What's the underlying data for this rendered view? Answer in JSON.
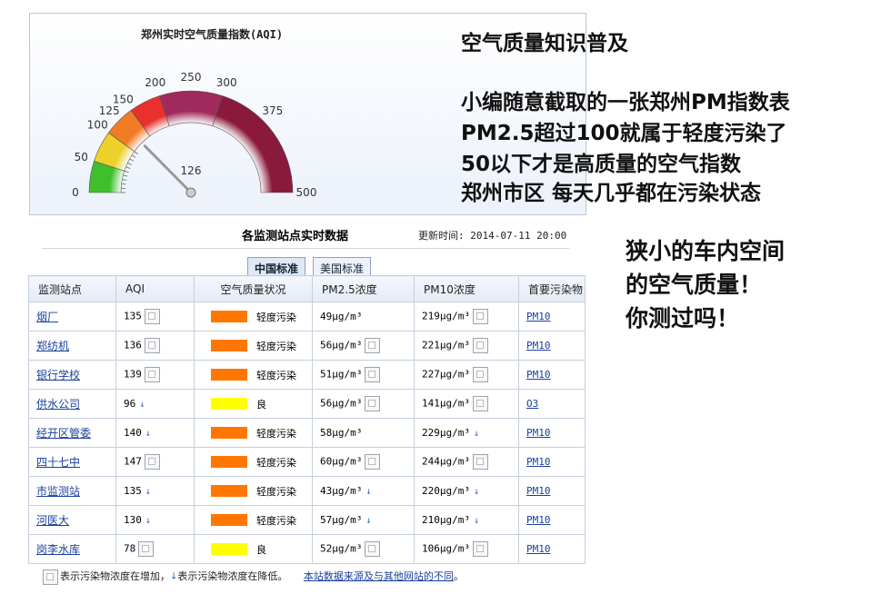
{
  "gauge": {
    "title": "郑州实时空气质量指数(AQI)",
    "value": 126,
    "value_label": "126",
    "min": 0,
    "max": 500,
    "ticks": [
      "0",
      "50",
      "100",
      "125",
      "150",
      "200",
      "250",
      "300",
      "375",
      "500"
    ],
    "band_colors": [
      "#3fbf2b",
      "#ecd12a",
      "#f27b25",
      "#e8302c",
      "#a02a5c",
      "#8a1a3c"
    ]
  },
  "overlay": {
    "heading": "空气质量知识普及",
    "lines": [
      "小编随意截取的一张郑州PM指数表",
      "PM2.5超过100就属于轻度污染了",
      "50以下才是高质量的空气指数",
      "郑州市区 每天几乎都在污染状态"
    ],
    "right_lines": [
      "狭小的车内空间",
      "的空气质量！",
      "你测过吗！"
    ]
  },
  "stations": {
    "title": "各监测站点实时数据",
    "update_time": "更新时间: 2014-07-11 20:00",
    "tabs": [
      "中国标准",
      "美国标准"
    ],
    "columns": [
      "监测站点",
      "AQI",
      "空气质量状况",
      "PM2.5浓度",
      "PM10浓度",
      "首要污染物"
    ],
    "level_colors": {
      "轻度污染": "#ff7700",
      "良": "#ffff00"
    },
    "rows": [
      {
        "name": "烟厂",
        "aqi": "135",
        "aqi_trend": "up",
        "level": "轻度污染",
        "pm25": "49μg/m³",
        "pm25_trend": "",
        "pm10": "219μg/m³",
        "pm10_trend": "up",
        "primary": "PM10"
      },
      {
        "name": "郑纺机",
        "aqi": "136",
        "aqi_trend": "up",
        "level": "轻度污染",
        "pm25": "56μg/m³",
        "pm25_trend": "up",
        "pm10": "221μg/m³",
        "pm10_trend": "up",
        "primary": "PM10"
      },
      {
        "name": "银行学校",
        "aqi": "139",
        "aqi_trend": "up",
        "level": "轻度污染",
        "pm25": "51μg/m³",
        "pm25_trend": "up",
        "pm10": "227μg/m³",
        "pm10_trend": "up",
        "primary": "PM10"
      },
      {
        "name": "供水公司",
        "aqi": "96",
        "aqi_trend": "down",
        "level": "良",
        "pm25": "56μg/m³",
        "pm25_trend": "up",
        "pm10": "141μg/m³",
        "pm10_trend": "up",
        "primary": "O3"
      },
      {
        "name": "经开区管委",
        "aqi": "140",
        "aqi_trend": "down",
        "level": "轻度污染",
        "pm25": "58μg/m³",
        "pm25_trend": "",
        "pm10": "229μg/m³",
        "pm10_trend": "down",
        "primary": "PM10"
      },
      {
        "name": "四十七中",
        "aqi": "147",
        "aqi_trend": "up",
        "level": "轻度污染",
        "pm25": "60μg/m³",
        "pm25_trend": "up",
        "pm10": "244μg/m³",
        "pm10_trend": "up",
        "primary": "PM10"
      },
      {
        "name": "市监测站",
        "aqi": "135",
        "aqi_trend": "down",
        "level": "轻度污染",
        "pm25": "43μg/m³",
        "pm25_trend": "down",
        "pm10": "220μg/m³",
        "pm10_trend": "down",
        "primary": "PM10"
      },
      {
        "name": "河医大",
        "aqi": "130",
        "aqi_trend": "down",
        "level": "轻度污染",
        "pm25": "57μg/m³",
        "pm25_trend": "down",
        "pm10": "210μg/m³",
        "pm10_trend": "down",
        "primary": "PM10"
      },
      {
        "name": "岗李水库",
        "aqi": "78",
        "aqi_trend": "up",
        "level": "良",
        "pm25": "52μg/m³",
        "pm25_trend": "up",
        "pm10": "106μg/m³",
        "pm10_trend": "up",
        "primary": "PM10"
      }
    ],
    "footer": {
      "up_text": "表示污染物浓度在增加，",
      "down_text": "表示污染物浓度在降低。",
      "link": "本站数据来源及与其他网站的不同",
      "end": "。"
    }
  }
}
